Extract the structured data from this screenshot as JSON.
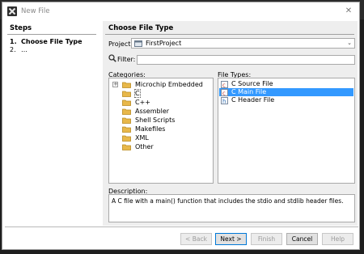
{
  "window": {
    "title": "New File",
    "app_icon": "x-logo-icon",
    "close_icon": "close-icon",
    "close_glyph": "✕"
  },
  "steps": {
    "heading": "Steps",
    "items": [
      {
        "num": "1.",
        "label": "Choose File Type",
        "active": true
      },
      {
        "num": "2.",
        "label": "…",
        "active": false
      }
    ]
  },
  "content": {
    "heading": "Choose File Type",
    "project": {
      "label": "Project:",
      "value": "FirstProject"
    },
    "filter": {
      "label": "Filter:",
      "value": ""
    },
    "categories": {
      "label": "Categories:",
      "items": [
        {
          "label": "Microchip Embedded",
          "expander": "+"
        },
        {
          "label": "C",
          "expander": ""
        },
        {
          "label": "C++",
          "expander": ""
        },
        {
          "label": "Assembler",
          "expander": ""
        },
        {
          "label": "Shell Scripts",
          "expander": ""
        },
        {
          "label": "Makefiles",
          "expander": ""
        },
        {
          "label": "XML",
          "expander": ""
        },
        {
          "label": "Other",
          "expander": ""
        }
      ]
    },
    "file_types": {
      "label": "File Types:",
      "items": [
        {
          "label": "C Source File",
          "selected": false
        },
        {
          "label": "C Main File",
          "selected": true
        },
        {
          "label": "C Header File",
          "selected": false
        }
      ]
    },
    "description": {
      "label": "Description:",
      "text": "A C file with a main() function that includes the stdio and stdlib header files."
    }
  },
  "buttons": {
    "back": {
      "label": "< Back",
      "enabled": false
    },
    "next": {
      "label": "Next >",
      "enabled": true
    },
    "finish": {
      "label": "Finish",
      "enabled": false
    },
    "cancel": {
      "label": "Cancel",
      "enabled": true
    },
    "help": {
      "label": "Help",
      "enabled": false
    }
  },
  "colors": {
    "selection": "#3399ff",
    "folder": "#e8b84a",
    "content_bg": "#eeeeee"
  }
}
